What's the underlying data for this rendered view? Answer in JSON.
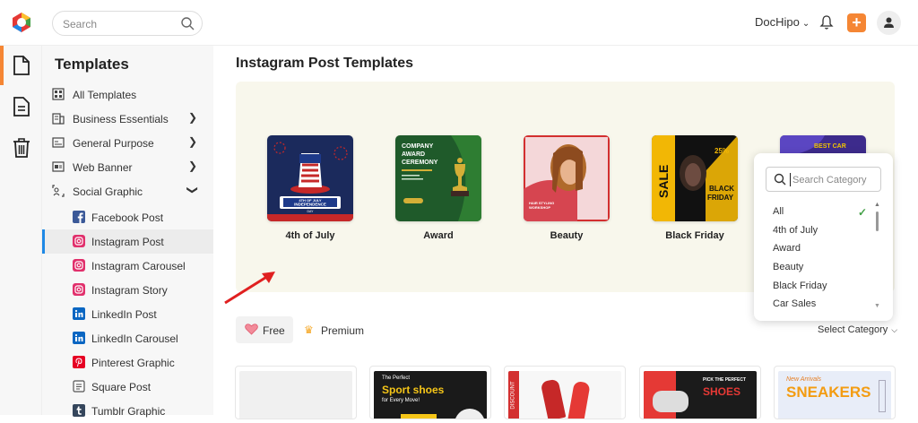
{
  "topbar": {
    "search_placeholder": "Search",
    "account_name": "DocHipo",
    "plus_label": "+",
    "colors": {
      "accent": "#f58634"
    }
  },
  "rail": {
    "items": [
      {
        "name": "file",
        "icon": "file-icon"
      },
      {
        "name": "document",
        "icon": "document-icon"
      },
      {
        "name": "trash",
        "icon": "trash-icon"
      }
    ]
  },
  "sidebar": {
    "title": "Templates",
    "items": [
      {
        "label": "All Templates",
        "icon": "grid-icon",
        "has_arrow": false
      },
      {
        "label": "Business Essentials",
        "icon": "building-icon",
        "has_arrow": true
      },
      {
        "label": "General Purpose",
        "icon": "layout-icon",
        "has_arrow": true
      },
      {
        "label": "Web Banner",
        "icon": "banner-icon",
        "has_arrow": true
      },
      {
        "label": "Social Graphic",
        "icon": "share-icon",
        "has_arrow": true
      }
    ],
    "sub_items": [
      {
        "label": "Facebook Post",
        "icon": "facebook-icon",
        "color": "#3b5998"
      },
      {
        "label": "Instagram Post",
        "icon": "instagram-icon",
        "color": "#e1306c",
        "active": true
      },
      {
        "label": "Instagram Carousel",
        "icon": "instagram-icon",
        "color": "#e1306c"
      },
      {
        "label": "Instagram Story",
        "icon": "instagram-icon",
        "color": "#e1306c"
      },
      {
        "label": "LinkedIn Post",
        "icon": "linkedin-icon",
        "color": "#0a66c2"
      },
      {
        "label": "LinkedIn Carousel",
        "icon": "linkedin-icon",
        "color": "#0a66c2"
      },
      {
        "label": "Pinterest Graphic",
        "icon": "pinterest-icon",
        "color": "#e60023"
      },
      {
        "label": "Square Post",
        "icon": "square-post-icon",
        "color": "#555555"
      },
      {
        "label": "Tumblr Graphic",
        "icon": "tumblr-icon",
        "color": "#35465c"
      }
    ]
  },
  "main": {
    "title": "Instagram Post Templates",
    "categories": [
      {
        "label": "4th of July"
      },
      {
        "label": "Award"
      },
      {
        "label": "Beauty"
      },
      {
        "label": "Black Friday"
      }
    ],
    "thumb_text": {
      "july_1": "4TH OF JULY",
      "july_2": "INDEPENDENCE",
      "july_3": "DAY",
      "award_1": "COMPANY",
      "award_2": "AWARD",
      "award_3": "CEREMONY",
      "beauty_1": "HAIR STYLING",
      "beauty_2": "WORKSHOP",
      "bf_sale": "SALE",
      "bf_pct": "25%",
      "bf_black": "BLACK",
      "bf_friday": "FRIDAY",
      "car_1": "BEST CAR"
    },
    "tabs": {
      "free": "Free",
      "premium": "Premium"
    },
    "select_category": "Select Category",
    "templates": [
      {
        "line1": ""
      },
      {
        "line1": "The Perfect",
        "line2": "Sport shoes",
        "line3": "for Every Move!"
      },
      {
        "line1": "DISCOUNT"
      },
      {
        "line1": "PICK THE PERFECT",
        "line2": "SHOES"
      },
      {
        "line1": "New Arrivals",
        "line2": "SNEAKERS"
      }
    ]
  },
  "dropdown": {
    "search_placeholder": "Search Category",
    "options": [
      "All",
      "4th of July",
      "Award",
      "Beauty",
      "Black Friday",
      "Car Sales"
    ],
    "selected": "All"
  }
}
